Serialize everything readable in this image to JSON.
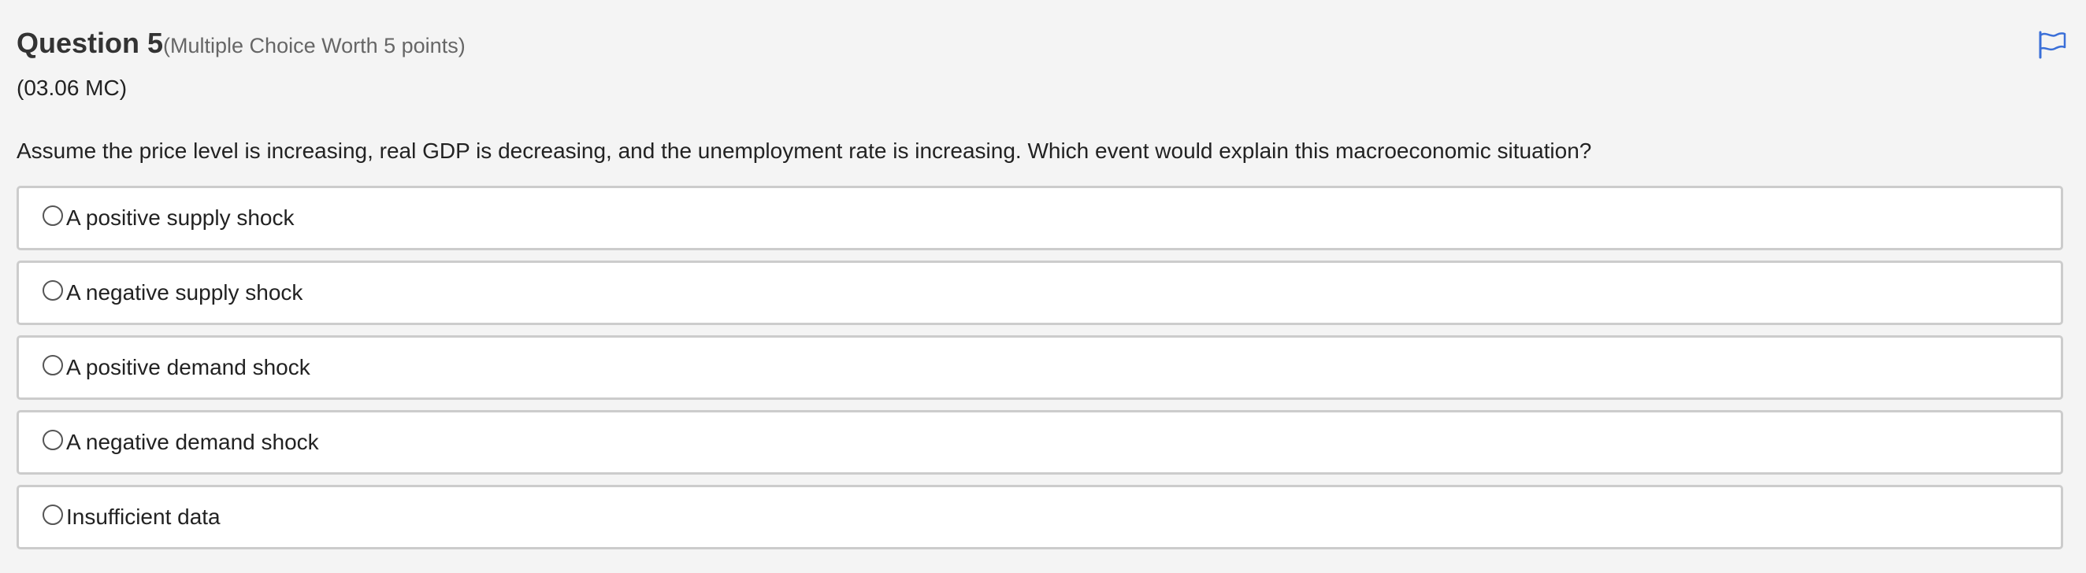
{
  "question": {
    "title": "Question 5",
    "worth": "(Multiple Choice Worth 5 points)",
    "code": "(03.06 MC)",
    "prompt": "Assume the price level is increasing, real GDP is decreasing, and the unemployment rate is increasing. Which event would explain this macroeconomic situation?"
  },
  "flag": {
    "icon": "flag-icon",
    "color": "#3a6fd8"
  },
  "options": [
    {
      "label": "A positive supply shock",
      "selected": false
    },
    {
      "label": "A negative supply shock",
      "selected": false
    },
    {
      "label": "A positive demand shock",
      "selected": false
    },
    {
      "label": "A negative demand shock",
      "selected": false
    },
    {
      "label": "Insufficient data",
      "selected": false
    }
  ]
}
